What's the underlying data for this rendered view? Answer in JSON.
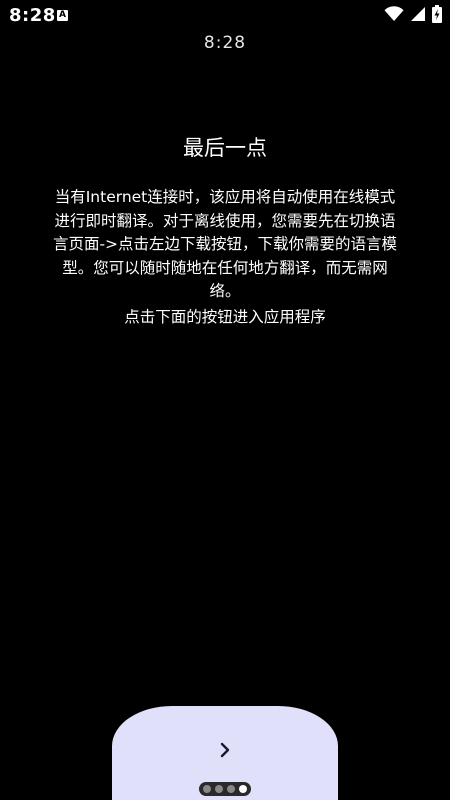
{
  "status_bar": {
    "time": "8:28",
    "app_icon_letter": "A"
  },
  "clock": "8:28",
  "page": {
    "title": "最后一点",
    "body_lines": [
      "当有Internet连接时，该应用将自动使用在线模式",
      "进行即时翻译。对于离线使用，您需要先在切换语",
      "言页面->点击左边下载按钮，下载你需要的语言模",
      "型。您可以随时随地在任何地方翻译，而无需网",
      "络。"
    ],
    "instruction": "点击下面的按钮进入应用程序"
  },
  "navigation": {
    "page_count": 4,
    "active_index": 3
  },
  "colors": {
    "background": "#000000",
    "button_panel": "#e0e0fb",
    "chevron": "#1a1a2e"
  }
}
